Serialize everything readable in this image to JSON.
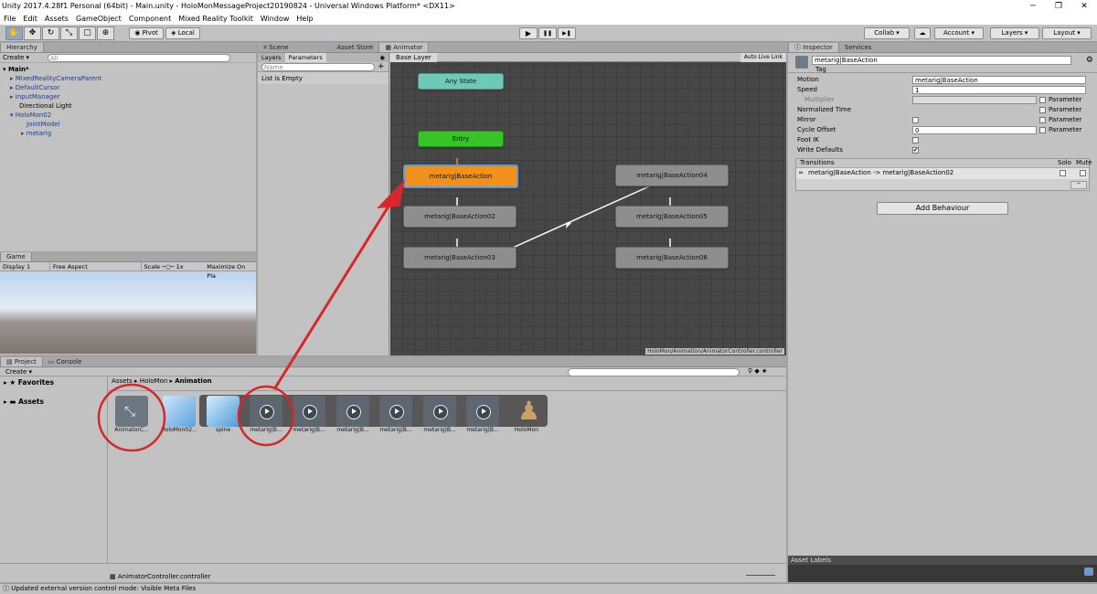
{
  "window": {
    "title": "Unity 2017.4.28f1 Personal (64bit) - Main.unity - HoloMonMessageProject20190824 - Universal Windows Platform* <DX11>",
    "min": "─",
    "max": "❐",
    "close": "✕"
  },
  "menu": [
    "File",
    "Edit",
    "Assets",
    "GameObject",
    "Component",
    "Mixed Reality Toolkit",
    "Window",
    "Help"
  ],
  "toolbar": {
    "pivot": "Pivot",
    "local": "Local",
    "collab": "Collab ▾",
    "account": "Account",
    "layers": "Layers",
    "layout": "Layout",
    "play": "▶",
    "pause": "❚❚",
    "step": "▶❚",
    "cloud": "☁"
  },
  "hierarchy": {
    "tab": "Hierarchy",
    "create": "Create",
    "search": "All",
    "scene": "Main*",
    "items": [
      "MixedRealityCameraParent",
      "DefaultCursor",
      "InputManager",
      "Directional Light",
      "HoloMon02",
      "JointModel",
      "metarig"
    ]
  },
  "game": {
    "tab": "Game",
    "display": "Display 1",
    "aspect": "Free Aspect",
    "scale": "Scale",
    "scale_val": "1x",
    "maximize": "Maximize On Pla"
  },
  "animator": {
    "tabs": [
      "Scene",
      "Asset Store",
      "Animator"
    ],
    "layers_tab": "Layers",
    "params_tab": "Parameters",
    "search": "Name",
    "list_empty": "List is Empty",
    "base_layer": "Base Layer",
    "auto_live": "Auto Live Link",
    "path": "HoloMon/Animation/AnimatorController.controller",
    "nodes": {
      "any": "Any State",
      "entry": "Entry",
      "n1": "metarig|BaseAction",
      "n2": "metarig|BaseAction02",
      "n3": "metarig|BaseAction03",
      "n4": "metarig|BaseAction04",
      "n5": "metarig|BaseAction05",
      "n6": "metarig|BaseAction06"
    }
  },
  "inspector": {
    "tabs": [
      "Inspector",
      "Services"
    ],
    "name": "metarig|BaseAction",
    "tag": "Tag",
    "rows": [
      {
        "label": "Motion",
        "value": "metarig|BaseAction"
      },
      {
        "label": "Speed",
        "value": "1"
      },
      {
        "label": "Multiplier",
        "value": ""
      },
      {
        "label": "Normalized Time",
        "value": ""
      },
      {
        "label": "Mirror",
        "value": ""
      },
      {
        "label": "Cycle Offset",
        "value": "0"
      },
      {
        "label": "Foot IK",
        "value": ""
      },
      {
        "label": "Write Defaults",
        "value": "✔"
      }
    ],
    "parameter": "Parameter",
    "transitions": "Transitions",
    "solo": "Solo",
    "mute": "Mute",
    "transition_item": "metarig|BaseAction -> metarig|BaseAction02",
    "add_behaviour": "Add Behaviour",
    "asset_labels": "Asset Labels"
  },
  "project": {
    "tabs": [
      "Project",
      "Console"
    ],
    "create": "Create",
    "favorites": "Favorites",
    "assets": "Assets",
    "breadcrumb": [
      "Assets",
      "HoloMon",
      "Animation"
    ],
    "bottom_file": "AnimatorController.controller",
    "items": [
      "AnimatorC...",
      "HoloMon02...",
      "spine",
      "metarig|B...",
      "metarig|B...",
      "metarig|B...",
      "metarig|B...",
      "metarig|B...",
      "metarig|B...",
      "HoloMon"
    ]
  },
  "status": "Updated external version control mode: Visible Meta Files"
}
